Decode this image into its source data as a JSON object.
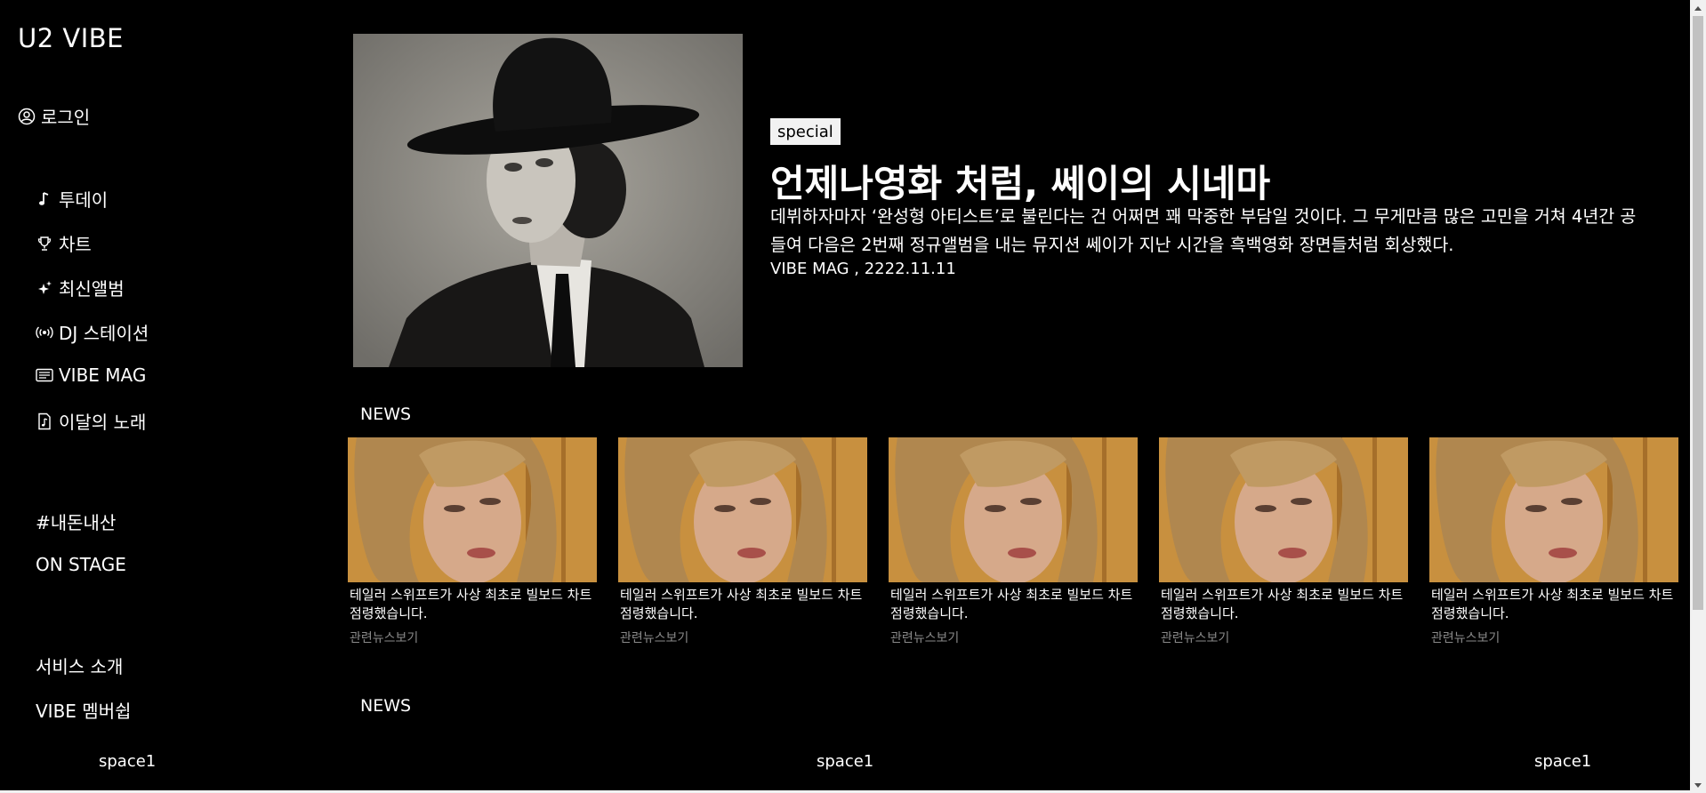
{
  "app": {
    "logo": "U2 VIBE"
  },
  "sidebar": {
    "login_label": "로그인",
    "nav": [
      {
        "label": "투데이",
        "icon": "music-note-icon"
      },
      {
        "label": "차트",
        "icon": "trophy-icon"
      },
      {
        "label": "최신앨범",
        "icon": "sparkle-icon"
      },
      {
        "label": "DJ 스테이션",
        "icon": "broadcast-icon"
      },
      {
        "label": "VIBE MAG",
        "icon": "magazine-icon"
      },
      {
        "label": "이달의 노래",
        "icon": "music-file-icon"
      }
    ],
    "tags": [
      "#내돈내산",
      "ON STAGE"
    ],
    "footer_links": [
      "서비스 소개",
      "VIBE 멤버쉽"
    ]
  },
  "feature": {
    "badge": "special",
    "title": "언제나영화 처럼, 쎄이의 시네마",
    "description": "데뷔하자마자 ‘완성형 아티스트’로 불린다는 건 어쩌면 꽤 막중한 부담일 것이다. 그 무게만큼 많은 고민을 거쳐 4년간 공들여 다음은 2번째 정규앨범을 내는 뮤지션 쎄이가 지난 시간을 흑백영화 장면들처럼 회상했다.",
    "meta": "VIBE MAG , 2222.11.11"
  },
  "news": {
    "title": "NEWS",
    "cards": [
      {
        "caption": "테일러 스위프트가 사상 최초로 빌보드 차트 점령했습니다.",
        "more": "관련뉴스보기"
      },
      {
        "caption": "테일러 스위프트가 사상 최초로 빌보드 차트 점령했습니다.",
        "more": "관련뉴스보기"
      },
      {
        "caption": "테일러 스위프트가 사상 최초로 빌보드 차트 점령했습니다.",
        "more": "관련뉴스보기"
      },
      {
        "caption": "테일러 스위프트가 사상 최초로 빌보드 차트 점령했습니다.",
        "more": "관련뉴스보기"
      },
      {
        "caption": "테일러 스위프트가 사상 최초로 빌보드 차트 점령했습니다.",
        "more": "관련뉴스보기"
      }
    ]
  },
  "news2": {
    "title": "NEWS"
  },
  "spaces": [
    "space1",
    "space1",
    "space1"
  ]
}
